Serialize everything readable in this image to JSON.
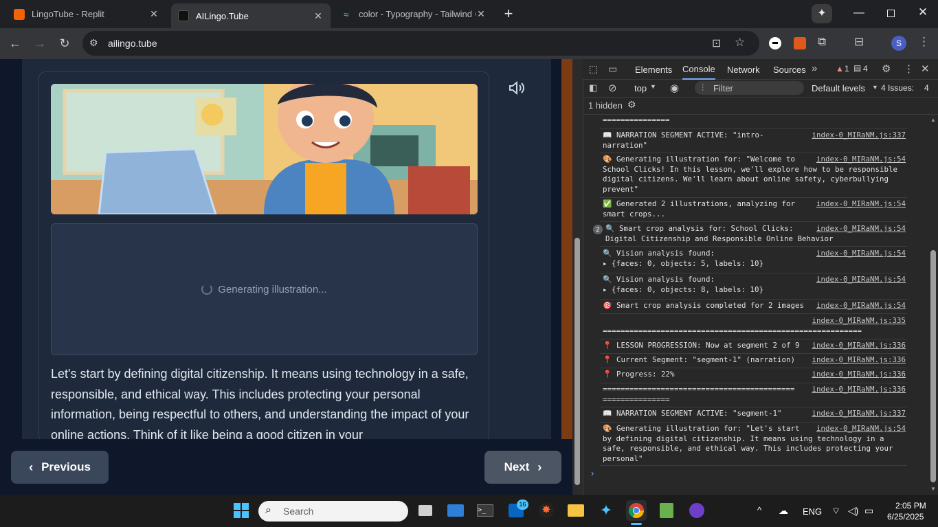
{
  "tabs": [
    {
      "title": "LingoTube - Replit",
      "favicon_color": "#f26207"
    },
    {
      "title": "AILingo.Tube",
      "favicon_color": "#111111"
    },
    {
      "title": "color - Typography - Tailwind C",
      "favicon_color": "#38bdf8"
    }
  ],
  "toolbar": {
    "url": "ailingo.tube",
    "profile_initial": "S"
  },
  "page": {
    "placeholder_text": "Generating illustration...",
    "narration": "Let's start by defining digital citizenship. It means using technology in a safe, responsible, and ethical way. This includes protecting your personal information, being respectful to others, and understanding the impact of your online actions. Think of it like being a good citizen in your",
    "prev_label": "Previous",
    "next_label": "Next"
  },
  "devtools": {
    "tabs": [
      "Elements",
      "Console",
      "Network",
      "Sources"
    ],
    "active_tab": "Console",
    "errors_count": "1",
    "messages_count": "4",
    "context": "top",
    "filter_placeholder": "Filter",
    "levels": "Default levels",
    "issues": "4 Issues:",
    "issues_count": "4",
    "hidden": "1 hidden",
    "logs": [
      {
        "text": "==============="
      },
      {
        "text": "📖 NARRATION SEGMENT ACTIVE: \"intro-\nnarration\"",
        "src": "index-0_MIRaNM.js:337"
      },
      {
        "text": "🎨 Generating illustration for: \"Welcome to\nSchool Clicks! In this lesson, we'll explore how to be responsible\ndigital citizens. We'll learn about online safety, cyberbullying\nprevent\"",
        "src": "index-0_MIRaNM.js:54"
      },
      {
        "text": "✅ Generated 2 illustrations, analyzing for\nsmart crops...",
        "src": "index-0_MIRaNM.js:54"
      },
      {
        "text": "🔍 Smart crop analysis for: School Clicks:\nDigital Citizenship and Responsible Online Behavior",
        "src": "index-0_MIRaNM.js:54",
        "count": "2"
      },
      {
        "text": "🔍 Vision analysis found:\n▸ {faces: 0, objects: 5, labels: 10}",
        "src": "index-0_MIRaNM.js:54"
      },
      {
        "text": "🔍 Vision analysis found:\n▸ {faces: 0, objects: 8, labels: 10}",
        "src": "index-0_MIRaNM.js:54"
      },
      {
        "text": "🎯 Smart crop analysis completed for 2 images",
        "src": "index-0_MIRaNM.js:54"
      },
      {
        "text": "\n==========================================================",
        "src": "index-0_MIRaNM.js:335"
      },
      {
        "text": "📍 LESSON PROGRESSION: Now at segment 2 of 9",
        "src": "index-0_MIRaNM.js:336"
      },
      {
        "text": "📍 Current Segment: \"segment-1\" (narration)",
        "src": "index-0_MIRaNM.js:336"
      },
      {
        "text": "📍 Progress: 22%",
        "src": "index-0_MIRaNM.js:336"
      },
      {
        "text": "===========================================\n===============",
        "src": "index-0_MIRaNM.js:336"
      },
      {
        "text": "📖 NARRATION SEGMENT ACTIVE: \"segment-1\"",
        "src": "index-0_MIRaNM.js:337"
      },
      {
        "text": "🎨 Generating illustration for: \"Let's start\nby defining digital citizenship. It means using technology in a\nsafe, responsible, and ethical way. This includes protecting your\npersonal\"",
        "src": "index-0_MIRaNM.js:54"
      }
    ]
  },
  "taskbar": {
    "search_placeholder": "Search",
    "mail_badge": "16",
    "lang": "ENG",
    "time": "2:05 PM",
    "date": "6/25/2025"
  }
}
